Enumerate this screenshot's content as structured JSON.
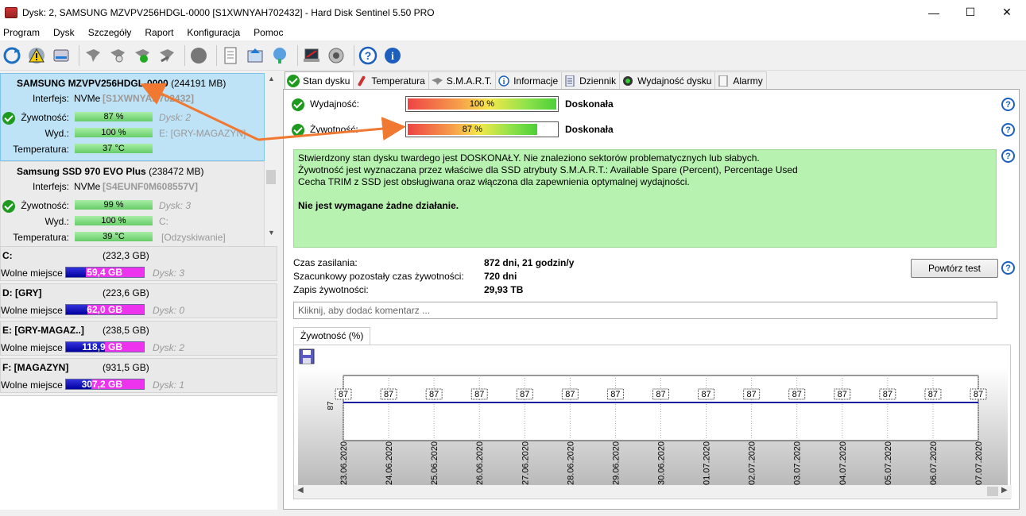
{
  "window": {
    "title": "Dysk: 2, SAMSUNG MZVPV256HDGL-0000 [S1XWNYAH702432]  -  Hard Disk Sentinel 5.50 PRO",
    "minimize": "—",
    "maximize": "☐",
    "close": "✕"
  },
  "menu": [
    "Program",
    "Dysk",
    "Szczegóły",
    "Raport",
    "Konfiguracja",
    "Pomoc"
  ],
  "toolbar_icons": [
    "refresh-icon",
    "warning-icon",
    "disk-icon",
    "hdd-sentinel-icon",
    "hdd-refresh-icon",
    "hdd-check-icon",
    "hdd-tool-icon",
    "gear-blob-icon",
    "document-icon",
    "update-icon",
    "network-icon",
    "laptop-icon",
    "speaker-icon",
    "help-icon",
    "info-icon"
  ],
  "disks": [
    {
      "name": "SAMSUNG MZVPV256HDGL-0000",
      "capacity": "(244191 MB)",
      "interface_label": "Interfejs:",
      "interface": "NVMe",
      "serial": "[S1XWNYAH702432]",
      "health_label": "Żywotność:",
      "health": "87 %",
      "disk_no": "Dysk: 2",
      "perf_label": "Wyd.:",
      "perf": "100 %",
      "volume": "E: [GRY-MAGAZYN]",
      "temp_label": "Temperatura:",
      "temp": "37 °C"
    },
    {
      "name": "Samsung SSD 970 EVO Plus",
      "capacity": "(238472 MB)",
      "interface_label": "Interfejs:",
      "interface": "NVMe",
      "serial": "[S4EUNF0M608557V]",
      "health_label": "Żywotność:",
      "health": "99 %",
      "disk_no": "Dysk: 3",
      "perf_label": "Wyd.:",
      "perf": "100 %",
      "volume": "C:",
      "temp_label": "Temperatura:",
      "temp": "39 °C",
      "extra": "[Odzyskiwanie]"
    }
  ],
  "volumes": [
    {
      "name": "C:",
      "capacity": "(232,3 GB)",
      "free_label": "Wolne miejsce",
      "free": "59,4 GB",
      "free_fraction": 0.26,
      "disk": "Dysk: 3"
    },
    {
      "name": "D: [GRY]",
      "capacity": "(223,6 GB)",
      "free_label": "Wolne miejsce",
      "free": "62,0 GB",
      "free_fraction": 0.28,
      "disk": "Dysk: 0"
    },
    {
      "name": "E: [GRY-MAGAZ..]",
      "capacity": "(238,5 GB)",
      "free_label": "Wolne miejsce",
      "free": "118,9 GB",
      "free_fraction": 0.5,
      "disk": "Dysk: 2"
    },
    {
      "name": "F: [MAGAZYN]",
      "capacity": "(931,5 GB)",
      "free_label": "Wolne miejsce",
      "free": "307,2 GB",
      "free_fraction": 0.33,
      "disk": "Dysk: 1"
    }
  ],
  "tabs": [
    "Stan dysku",
    "Temperatura",
    "S.M.A.R.T.",
    "Informacje",
    "Dziennik",
    "Wydajność dysku",
    "Alarmy"
  ],
  "status": {
    "perf_label": "Wydajność:",
    "perf_value": "100 %",
    "perf_fraction": 1.0,
    "perf_rating": "Doskonała",
    "health_label": "Żywotność:",
    "health_value": "87 %",
    "health_fraction": 0.87,
    "health_rating": "Doskonała",
    "message_lines": [
      "Stwierdzony stan dysku twardego jest DOSKONAŁY. Nie znaleziono sektorów problematycznych lub słabych.",
      "Żywotność jest wyznaczana przez właściwe dla SSD atrybuty S.M.A.R.T.:  Available Spare (Percent), Percentage Used",
      "Cecha TRIM z SSD jest obsługiwana oraz włączona dla zapewnienia optymalnej wydajności."
    ],
    "message_action": "Nie jest wymagane żadne działanie.",
    "power_on_label": "Czas zasilania:",
    "power_on": "872 dni, 21 godzin/y",
    "remaining_label": "Szacunkowy pozostały czas żywotności:",
    "remaining": "720 dni",
    "written_label": "Zapis żywotności:",
    "written": "29,93 TB",
    "retest_button": "Powtórz test",
    "comment_placeholder": "Kliknij, aby dodać komentarz ...",
    "chart_tab": "Żywotność (%)",
    "help": "?"
  },
  "chart_data": {
    "type": "line",
    "title": "",
    "ylabel": "87",
    "x": [
      "23.06.2020",
      "24.06.2020",
      "25.06.2020",
      "26.06.2020",
      "27.06.2020",
      "28.06.2020",
      "29.06.2020",
      "30.06.2020",
      "01.07.2020",
      "02.07.2020",
      "03.07.2020",
      "04.07.2020",
      "05.07.2020",
      "06.07.2020",
      "07.07.2020"
    ],
    "series": [
      {
        "values": [
          87,
          87,
          87,
          87,
          87,
          87,
          87,
          87,
          87,
          87,
          87,
          87,
          87,
          87,
          87
        ]
      }
    ],
    "line_color": "#1a1aa0",
    "grid": true
  },
  "colors": {
    "selected_disk_bg": "#bfe3f6",
    "health_bar": "#66cc66",
    "message_bg": "#b8f2b0",
    "free_space": "#0000a0",
    "used_space": "#ee33ee",
    "arrow": "#f07830"
  }
}
